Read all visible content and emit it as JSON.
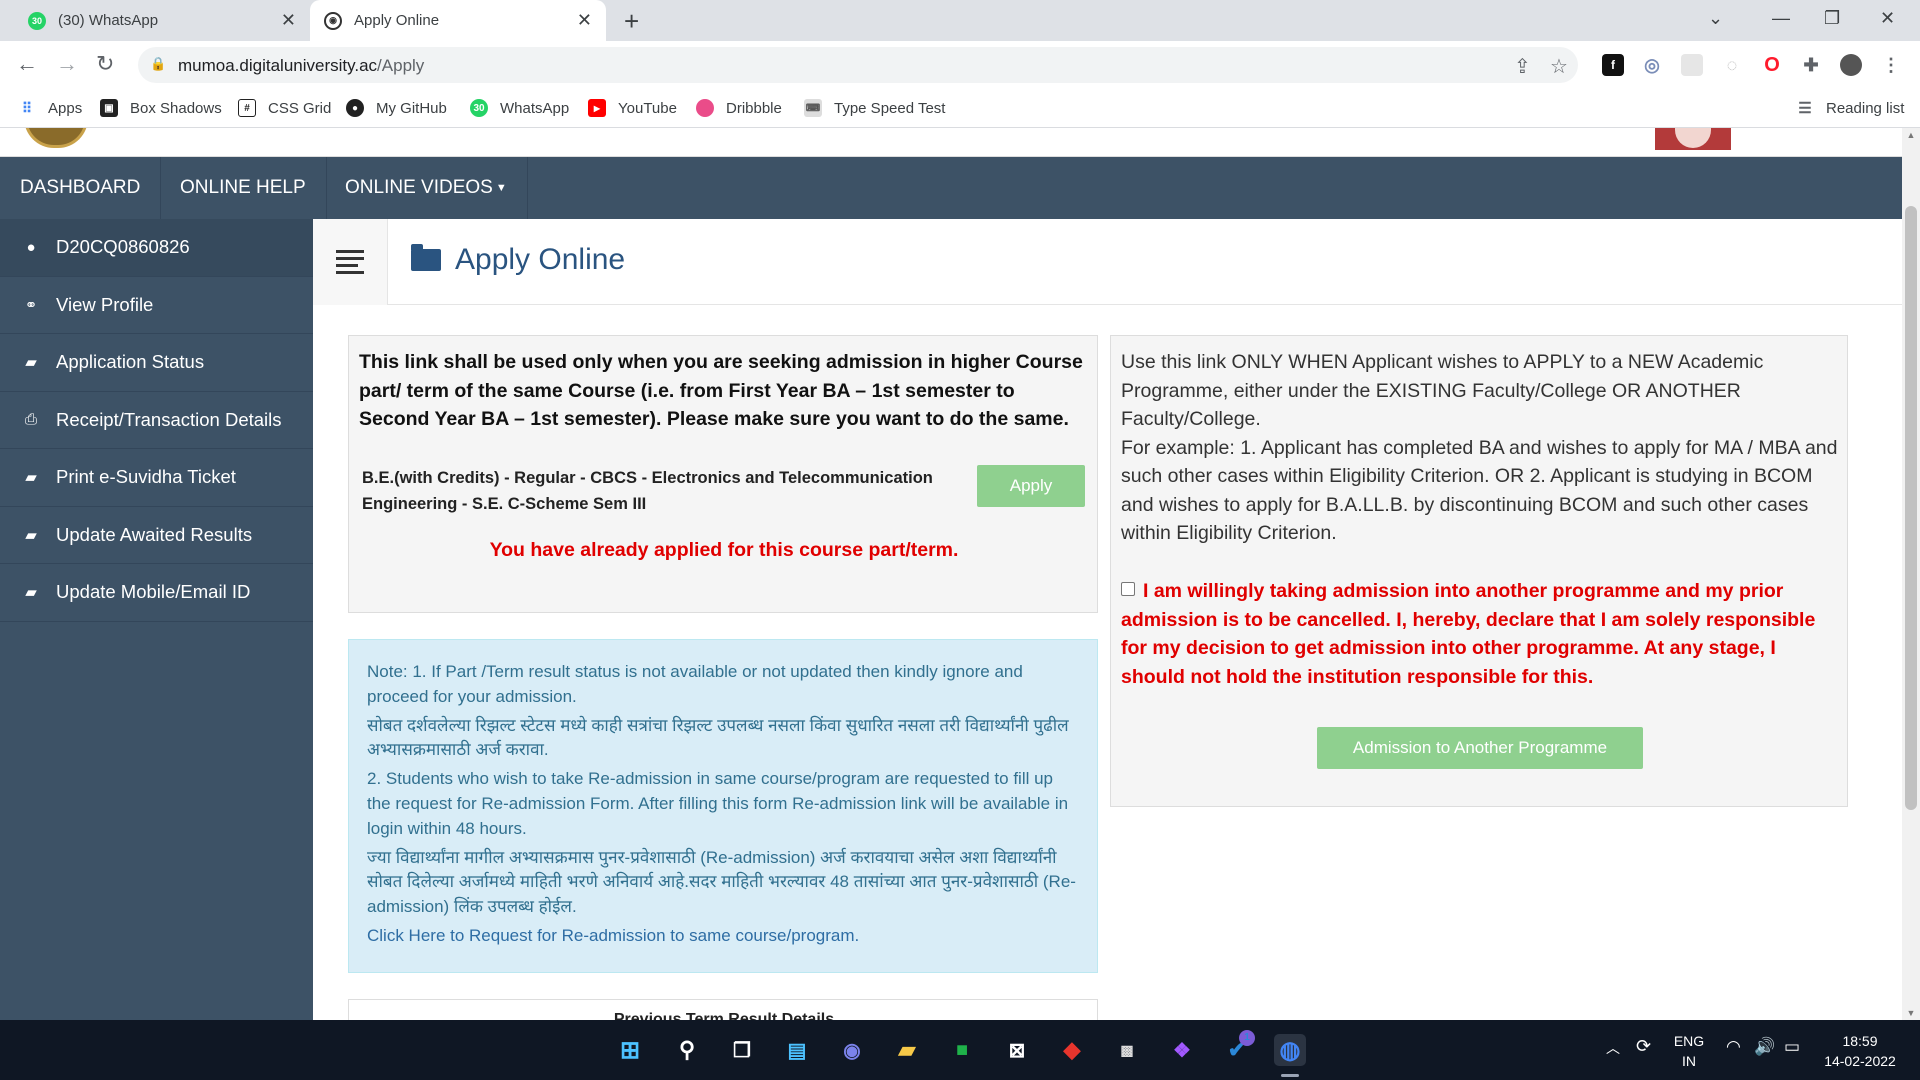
{
  "browser": {
    "tabs": [
      {
        "title": "(30) WhatsApp",
        "badge": "30"
      },
      {
        "title": "Apply Online"
      }
    ],
    "url_domain": "mumoa.digitaluniversity.ac",
    "url_path": "/Apply",
    "bookmarks": [
      "Apps",
      "Box Shadows",
      "CSS Grid",
      "My GitHub",
      "WhatsApp",
      "YouTube",
      "Dribbble",
      "Type Speed Test"
    ],
    "reading_list": "Reading list"
  },
  "topnav": {
    "dashboard": "DASHBOARD",
    "online_help": "ONLINE HELP",
    "online_videos": "ONLINE VIDEOS"
  },
  "sidebar": {
    "items": [
      {
        "label": "D20CQ0860826",
        "icon": "user-icon"
      },
      {
        "label": "View Profile",
        "icon": "link-icon"
      },
      {
        "label": "Application Status",
        "icon": "folder-icon"
      },
      {
        "label": "Receipt/Transaction Details",
        "icon": "print-icon"
      },
      {
        "label": "Print e-Suvidha Ticket",
        "icon": "folder-icon"
      },
      {
        "label": "Update Awaited Results",
        "icon": "folder-icon"
      },
      {
        "label": "Update Mobile/Email ID",
        "icon": "folder-icon"
      }
    ]
  },
  "page": {
    "title": "Apply Online"
  },
  "same_course": {
    "instruction": "This link shall be used only when you are seeking admission in higher Course part/ term of the same Course (i.e. from First Year BA – 1st semester to Second Year BA – 1st semester). Please make sure you want to do the same.",
    "course": "B.E.(with Credits) - Regular - CBCS - Electronics and Telecommunication Engineering - S.E. C-Scheme Sem III",
    "apply_label": "Apply",
    "already_applied": "You have already applied for this course part/term."
  },
  "note": {
    "line1": "Note: 1. If Part /Term result status is not available or not updated then kindly ignore and proceed for your admission.",
    "line1_mr": "सोबत दर्शवलेल्या रिझल्ट स्टेटस मध्ये काही सत्रांचा रिझल्ट उपलब्ध नसला किंवा सुधारित नसला तरी विद्यार्थ्यांनी पुढील अभ्यासक्रमासाठी अर्ज करावा.",
    "line2": "2. Students who wish to take Re-admission in same course/program are requested to fill up the request for Re-admission Form. After filling this form Re-admission link will be available in login within 48 hours.",
    "line2_mr": "ज्या विद्यार्थ्यांना मागील अभ्यासक्रमास पुनर-प्रवेशासाठी (Re-admission) अर्ज करावयाचा असेल अशा विद्यार्थ्यांनी सोबत दिलेल्या अर्जामध्ये माहिती भरणे अनिवार्य आहे.सदर माहिती भरल्यावर 48 तासांच्या आत पुनर-प्रवेशासाठी (Re-admission) लिंक उपलब्ध होईल.",
    "readmission_link": "Click Here to Request for Re-admission to same course/program."
  },
  "previous_term": {
    "heading": "Previous Term Result Details"
  },
  "new_programme": {
    "text1": "Use this link ONLY WHEN Applicant wishes to APPLY to a NEW Academic Programme, either under the EXISTING Faculty/College OR ANOTHER Faculty/College.",
    "text2": "For example: 1. Applicant has completed BA and wishes to apply for MA / MBA and such other cases within Eligibility Criterion. OR 2. Applicant is studying in BCOM and wishes to apply for B.A.LL.B. by discontinuing BCOM and such other cases within Eligibility Criterion.",
    "declaration": "I am willingly taking admission into another programme and my prior admission is to be cancelled. I, hereby, declare that I am solely responsible for my decision to get admission into other programme. At any stage, I should not hold the institution responsible for this.",
    "declaration_checked": false,
    "button_label": "Admission to Another Programme"
  },
  "taskbar": {
    "language": "ENG",
    "region": "IN",
    "time": "18:59",
    "date": "14-02-2022",
    "notification_badge": "1"
  },
  "colors": {
    "nav_bg": "#3d5266",
    "title_blue": "#2a5480",
    "warning_red": "#e00000",
    "button_green": "#8fd08f",
    "note_bg": "#d9edf7"
  }
}
